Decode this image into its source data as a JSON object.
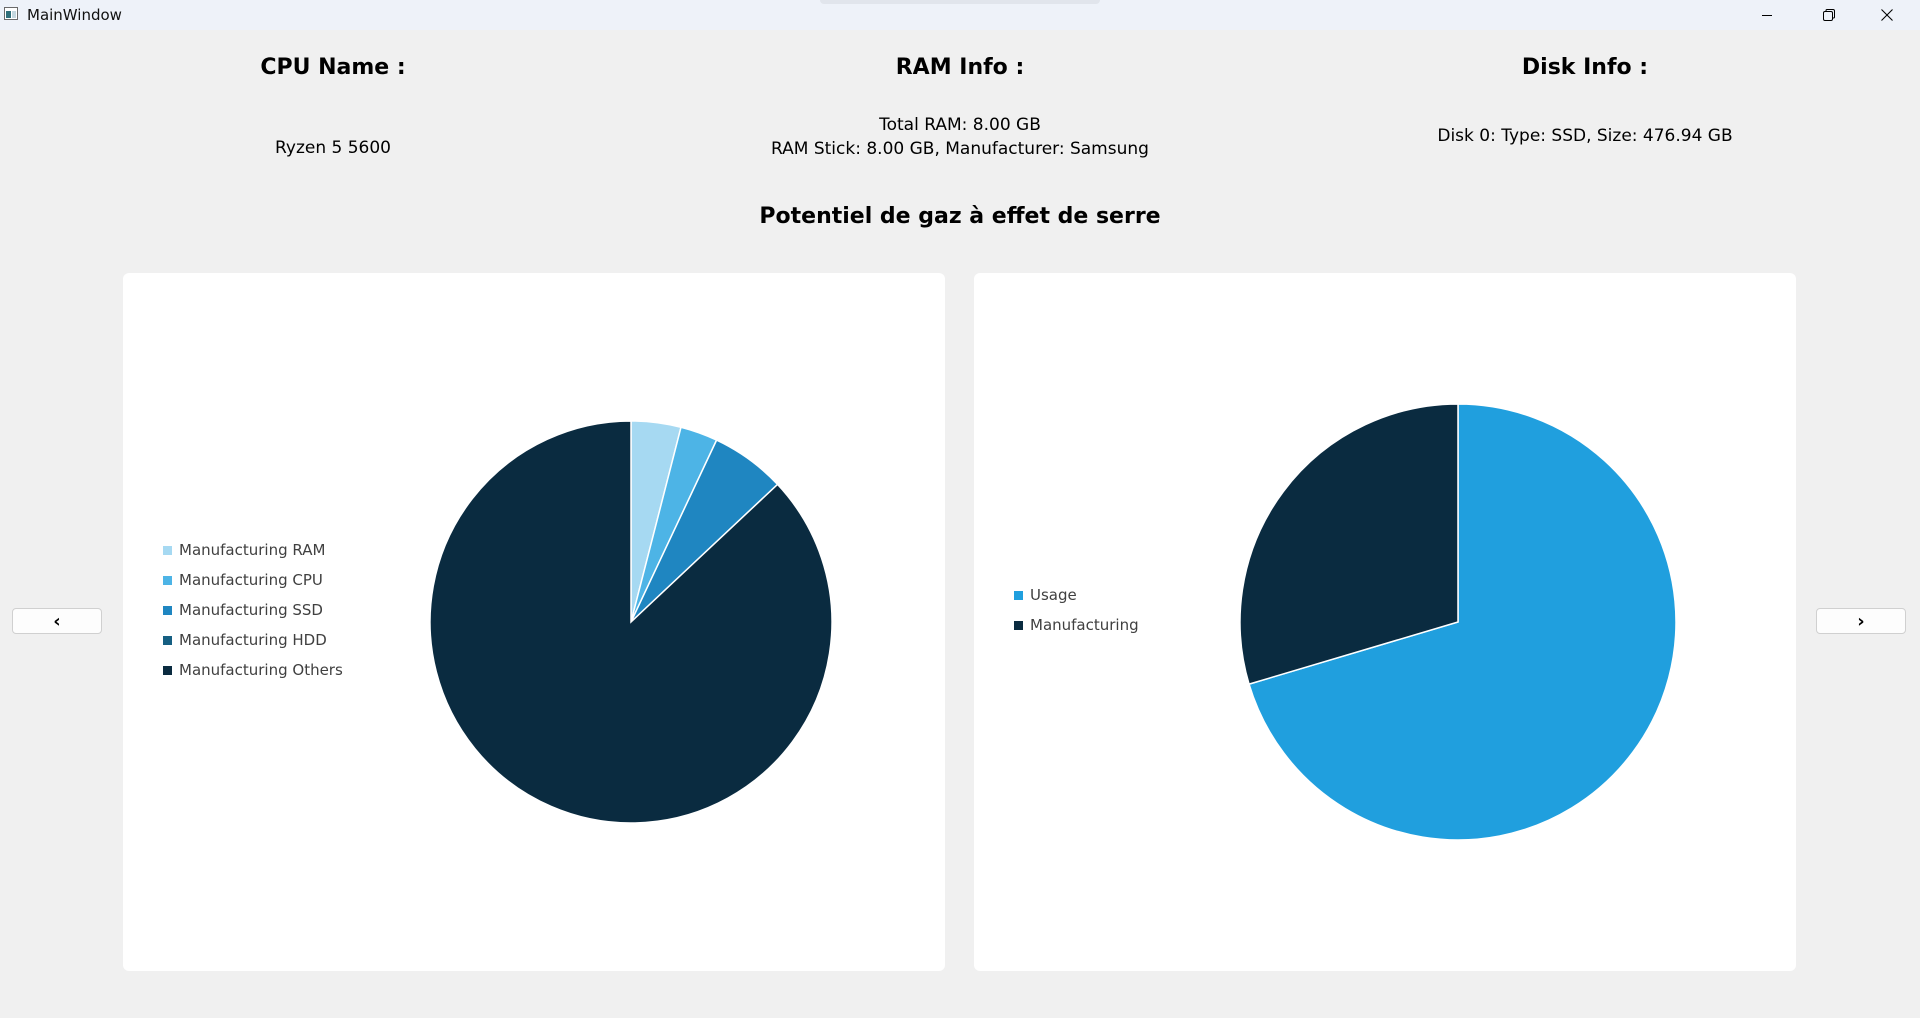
{
  "window": {
    "title": "MainWindow",
    "controls": [
      "minimize-icon",
      "restore-icon",
      "close-icon"
    ]
  },
  "cpu": {
    "label": "CPU Name :",
    "value": "Ryzen 5 5600"
  },
  "ram": {
    "label": "RAM Info :",
    "lines": [
      "Total RAM: 8.00 GB",
      "RAM Stick: 8.00 GB, Manufacturer: Samsung"
    ]
  },
  "disk": {
    "label": "Disk Info :",
    "lines": [
      "Disk 0: Type: SSD, Size: 476.94 GB"
    ]
  },
  "section_title": "Potentiel de gaz à effet de serre",
  "navigation": {
    "prev_label": "‹",
    "next_label": "›"
  },
  "chart_data": [
    {
      "type": "pie",
      "title": "",
      "legend_placement": "left",
      "slices": [
        {
          "name": "Manufacturing RAM",
          "value": 4.0,
          "color": "#a6d9f2"
        },
        {
          "name": "Manufacturing CPU",
          "value": 3.0,
          "color": "#4db4e6"
        },
        {
          "name": "Manufacturing SSD",
          "value": 6.0,
          "color": "#1f86c1"
        },
        {
          "name": "Manufacturing HDD",
          "value": 0.0,
          "color": "#155f82"
        },
        {
          "name": "Manufacturing Others",
          "value": 87.0,
          "color": "#0a2b40"
        }
      ]
    },
    {
      "type": "pie",
      "title": "",
      "legend_placement": "left",
      "slices": [
        {
          "name": "Usage",
          "value": 70.4,
          "color": "#209fde"
        },
        {
          "name": "Manufacturing",
          "value": 29.6,
          "color": "#0a2b40"
        }
      ]
    }
  ]
}
